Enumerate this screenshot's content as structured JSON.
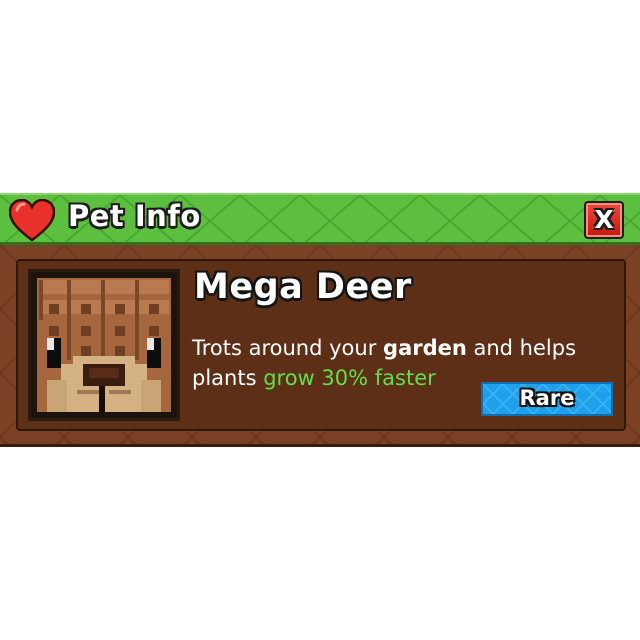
{
  "header": {
    "title": "Pet Info",
    "icon": "heart-icon",
    "close_label": "X",
    "close_icon": "close-icon",
    "color": "#5cbf3e"
  },
  "pet": {
    "name": "Mega Deer",
    "description": {
      "part1": "Trots around your ",
      "highlight": "garden",
      "part2": " and helps plants ",
      "effect": "grow 30% faster"
    },
    "rarity": "Rare",
    "rarity_color": "#1fa0ea",
    "portrait_icon": "deer-face-icon"
  },
  "colors": {
    "body": "#7a4125",
    "inner": "#5d2f16",
    "effect_green": "#5fe04a",
    "close_red": "#d9281c"
  }
}
